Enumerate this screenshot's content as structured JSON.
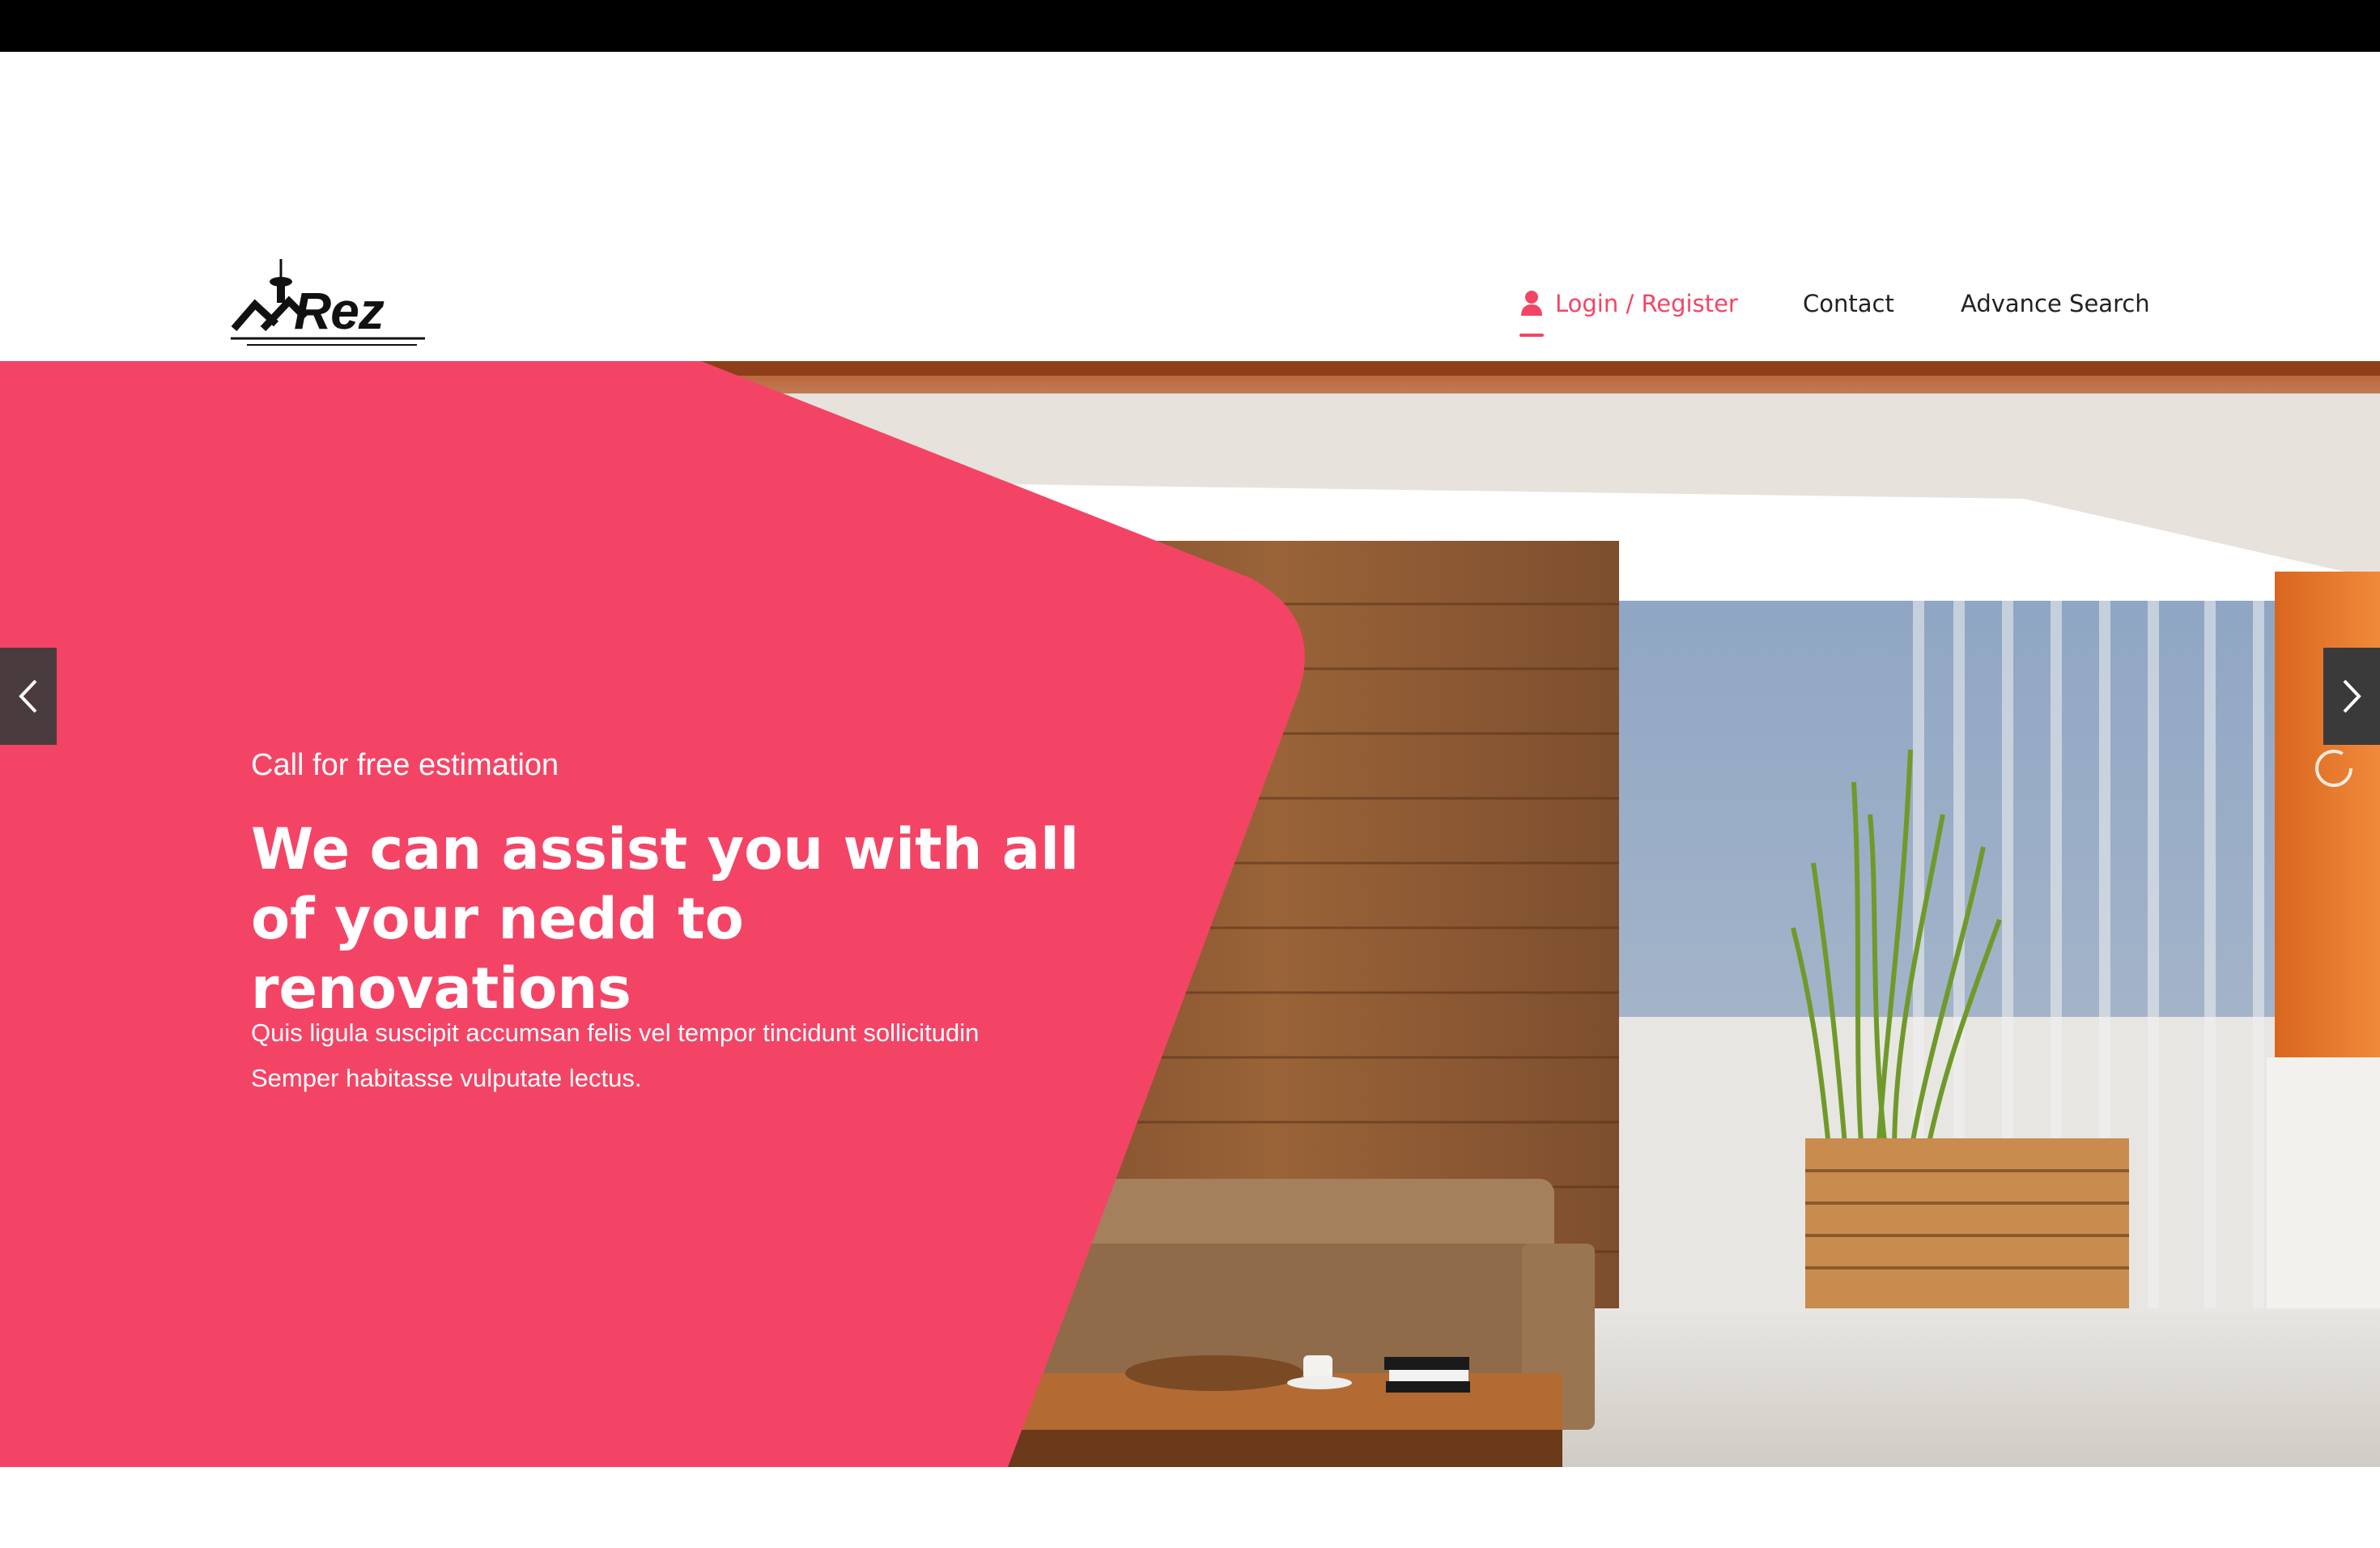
{
  "brand": {
    "logo_text": "Rez"
  },
  "nav": {
    "login_label": "Login / Register",
    "contact_label": "Contact",
    "advance_search_label": "Advance Search",
    "active_color": "#f44466"
  },
  "hero": {
    "kicker": "Call for free estimation",
    "title": "We can assist you with all of your nedd to renovations",
    "text": "Quis ligula suscipit accumsan felis vel tempor tincidunt sollicitudin Semper habitasse vulputate lectus.",
    "accent_color": "#f44466"
  },
  "icons": {
    "user": "user-icon",
    "prev": "chevron-left-icon",
    "next": "chevron-right-icon",
    "loader": "loading-spinner-icon"
  }
}
